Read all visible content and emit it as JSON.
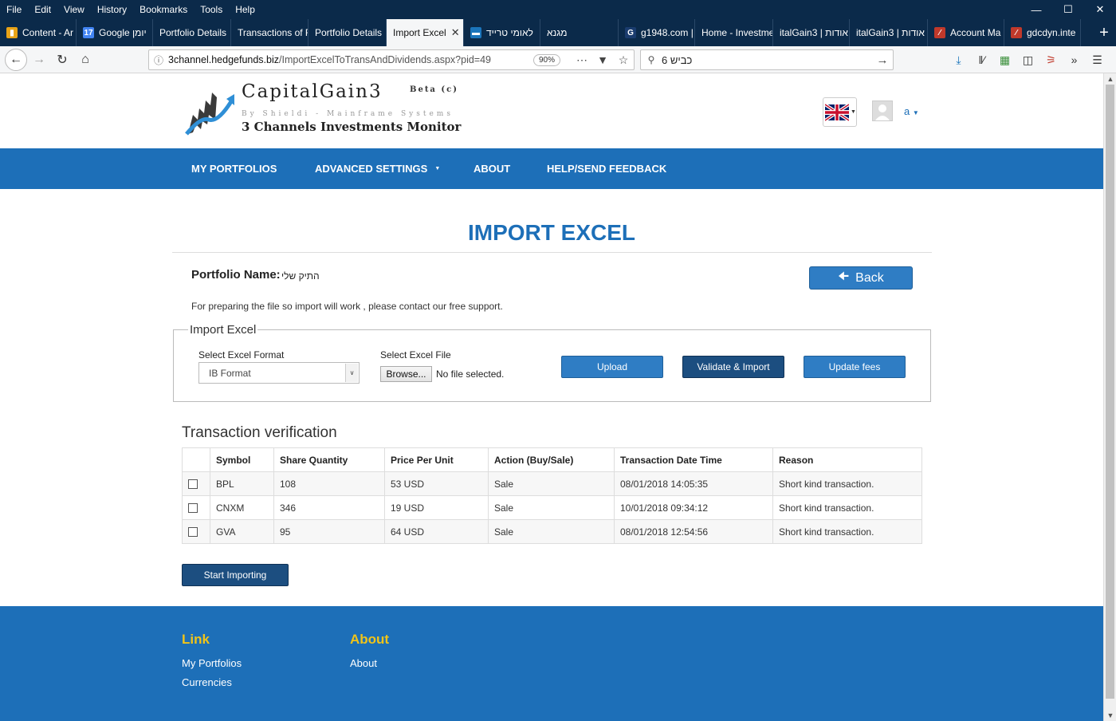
{
  "browser": {
    "menu": [
      "File",
      "Edit",
      "View",
      "History",
      "Bookmarks",
      "Tools",
      "Help"
    ],
    "tabs": [
      {
        "label": "Content - Ar",
        "active": false
      },
      {
        "label": "Google יומן",
        "active": false
      },
      {
        "label": "Portfolio Details",
        "active": false
      },
      {
        "label": "Transactions of F",
        "active": false
      },
      {
        "label": "Portfolio Details",
        "active": false
      },
      {
        "label": "Import Excel",
        "active": true
      },
      {
        "label": "לאומי טרייד",
        "active": false
      },
      {
        "label": "מגנא",
        "active": false
      },
      {
        "label": "g1948.com |",
        "active": false
      },
      {
        "label": "Home - Investme",
        "active": false
      },
      {
        "label": "italGain3 | אודות",
        "active": false
      },
      {
        "label": "italGain3 | אודות",
        "active": false
      },
      {
        "label": "Account Ma",
        "active": false
      },
      {
        "label": "gdcdyn.inte",
        "active": false
      }
    ],
    "url_domain": "3channel.hedgefunds.biz",
    "url_path": "/ImportExcelToTransAndDividends.aspx?pid=49",
    "zoom": "90%",
    "search_value": "כביש 6"
  },
  "header": {
    "brand": "CapitalGain3",
    "beta": "Beta (c)",
    "byline": "By Shieldi - Mainframe Systems",
    "subtitle": "3 Channels Investments Monitor",
    "user": "a"
  },
  "nav": {
    "items": [
      "MY PORTFOLIOS",
      "ADVANCED SETTINGS",
      "ABOUT",
      "HELP/SEND FEEDBACK"
    ]
  },
  "main": {
    "title": "IMPORT EXCEL",
    "portfolio_label": "Portfolio Name:",
    "portfolio_name": "התיק שלי",
    "back_label": "Back",
    "note": "For preparing the file so import will work , please contact our free support."
  },
  "import": {
    "legend": "Import Excel",
    "format_label": "Select Excel Format",
    "format_value": "IB Format",
    "file_label": "Select Excel File",
    "browse_label": "Browse...",
    "no_file": "No file selected.",
    "upload_label": "Upload",
    "validate_label": "Validate & Import",
    "fees_label": "Update fees"
  },
  "verification": {
    "title": "Transaction verification",
    "columns": [
      "Symbol",
      "Share Quantity",
      "Price Per Unit",
      "Action (Buy/Sale)",
      "Transaction Date Time",
      "Reason"
    ],
    "rows": [
      [
        "BPL",
        "108",
        "53 USD",
        "Sale",
        "08/01/2018 14:05:35",
        "Short kind transaction."
      ],
      [
        "CNXM",
        "346",
        "19 USD",
        "Sale",
        "10/01/2018 09:34:12",
        "Short kind transaction."
      ],
      [
        "GVA",
        "95",
        "64 USD",
        "Sale",
        "08/01/2018 12:54:56",
        "Short kind transaction."
      ]
    ],
    "start_label": "Start Importing"
  },
  "footer": {
    "link_heading": "Link",
    "links": [
      "My Portfolios",
      "Currencies"
    ],
    "about_heading": "About",
    "about_links": [
      "About"
    ]
  },
  "colors": {
    "brand_blue": "#1d6fb8",
    "dark_button": "#1c4e80",
    "footer_heading": "#f0c419"
  }
}
